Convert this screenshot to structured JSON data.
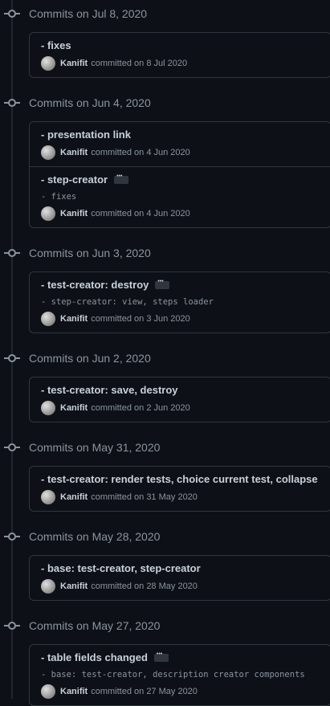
{
  "groups": [
    {
      "date_label": "Commits on Jul 8, 2020",
      "commits": [
        {
          "title": "- fixes",
          "has_more": false,
          "description": "",
          "author": "Kanifit",
          "committed": "committed on 8 Jul 2020"
        }
      ]
    },
    {
      "date_label": "Commits on Jun 4, 2020",
      "commits": [
        {
          "title": "- presentation link",
          "has_more": false,
          "description": "",
          "author": "Kanifit",
          "committed": "committed on 4 Jun 2020"
        },
        {
          "title": "- step-creator",
          "has_more": true,
          "description": "- fixes",
          "author": "Kanifit",
          "committed": "committed on 4 Jun 2020"
        }
      ]
    },
    {
      "date_label": "Commits on Jun 3, 2020",
      "commits": [
        {
          "title": "- test-creator: destroy",
          "has_more": true,
          "description": "- step-creator: view, steps loader",
          "author": "Kanifit",
          "committed": "committed on 3 Jun 2020"
        }
      ]
    },
    {
      "date_label": "Commits on Jun 2, 2020",
      "commits": [
        {
          "title": "- test-creator: save, destroy",
          "has_more": false,
          "description": "",
          "author": "Kanifit",
          "committed": "committed on 2 Jun 2020"
        }
      ]
    },
    {
      "date_label": "Commits on May 31, 2020",
      "commits": [
        {
          "title": "- test-creator: render tests, choice current test, collapse",
          "has_more": false,
          "description": "",
          "author": "Kanifit",
          "committed": "committed on 31 May 2020"
        }
      ]
    },
    {
      "date_label": "Commits on May 28, 2020",
      "commits": [
        {
          "title": "- base: test-creator, step-creator",
          "has_more": false,
          "description": "",
          "author": "Kanifit",
          "committed": "committed on 28 May 2020"
        }
      ]
    },
    {
      "date_label": "Commits on May 27, 2020",
      "commits": [
        {
          "title": "- table fields changed",
          "has_more": true,
          "description": "- base: test-creator, description creator components",
          "author": "Kanifit",
          "committed": "committed on 27 May 2020"
        }
      ]
    }
  ]
}
